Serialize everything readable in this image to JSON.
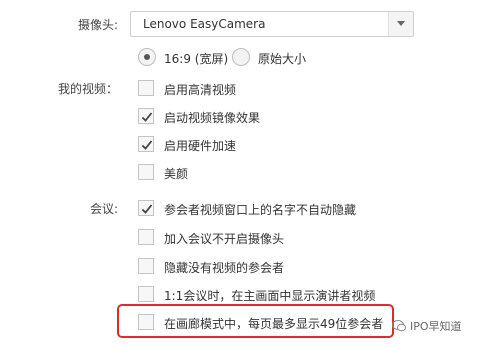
{
  "camera": {
    "label": "摄像头:",
    "selected": "Lenovo EasyCamera",
    "aspect_options": [
      {
        "label": "16:9 (宽屏)",
        "selected": true
      },
      {
        "label": "原始大小",
        "selected": false
      }
    ]
  },
  "my_video": {
    "label": "我的视频：",
    "options": [
      {
        "label": "启用高清视频",
        "checked": false
      },
      {
        "label": "启动视频镜像效果",
        "checked": true
      },
      {
        "label": "启用硬件加速",
        "checked": true
      },
      {
        "label": "美颜",
        "checked": false
      }
    ]
  },
  "meeting": {
    "label": "会议:",
    "options": [
      {
        "label": "参会者视频窗口上的名字不自动隐藏",
        "checked": true
      },
      {
        "label": "加入会议不开启摄像头",
        "checked": false
      },
      {
        "label": "隐藏没有视频的参会者",
        "checked": false
      },
      {
        "label": "1:1会议时，在主画面中显示演讲者视频",
        "checked": false
      },
      {
        "label": "在画廊模式中，每页最多显示49位参会者",
        "checked": false
      }
    ]
  },
  "watermark": "IPO早知道",
  "colors": {
    "highlight": "#e02a2a"
  }
}
